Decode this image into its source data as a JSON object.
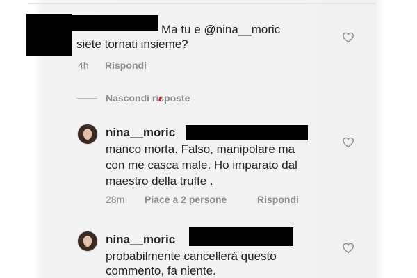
{
  "comment": {
    "text_line1": "Ma tu e @nina__moric",
    "text_line2": "siete tornati insieme?",
    "time": "4h",
    "reply_label": "Rispondi"
  },
  "hide_replies_label": "Nascondi risposte",
  "replies": [
    {
      "username": "nina__moric",
      "lines": [
        "manco morta. Falso, manipolare ma",
        "con me casca male. Ho imparato dal",
        "maestro della truffe ."
      ],
      "time": "28m",
      "likes": "Piace a 2 persone",
      "reply_label": "Rispondi"
    },
    {
      "username": "nina__moric",
      "lines": [
        "probabilmente cancellerà questo",
        "commento, fa niente."
      ]
    }
  ],
  "colors": {
    "text": "#222222",
    "meta": "#8e8e8e",
    "redaction": "#000000"
  },
  "icons": [
    "heart-icon",
    "avatar"
  ]
}
